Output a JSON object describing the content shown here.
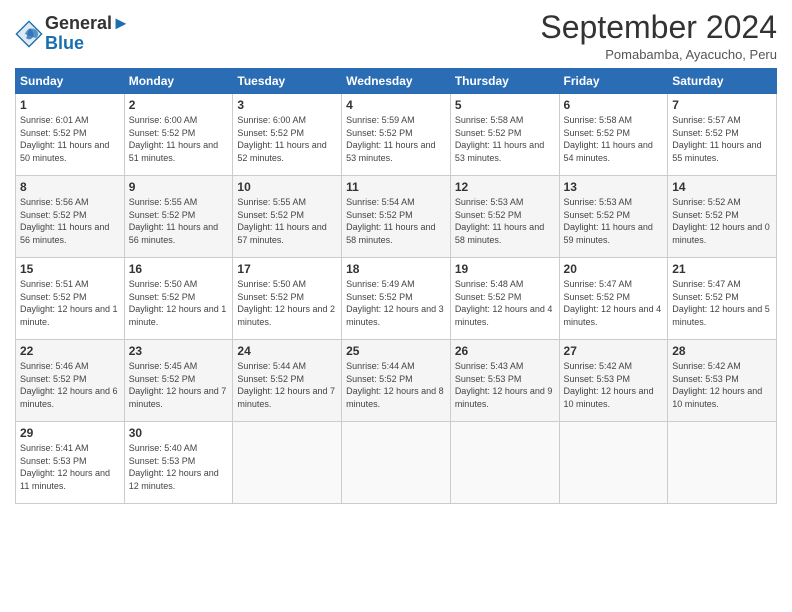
{
  "header": {
    "logo_line1": "General",
    "logo_line2": "Blue",
    "month_title": "September 2024",
    "location": "Pomabamba, Ayacucho, Peru"
  },
  "days_of_week": [
    "Sunday",
    "Monday",
    "Tuesday",
    "Wednesday",
    "Thursday",
    "Friday",
    "Saturday"
  ],
  "weeks": [
    [
      {
        "day": "1",
        "sunrise": "6:01 AM",
        "sunset": "5:52 PM",
        "daylight": "11 hours and 50 minutes."
      },
      {
        "day": "2",
        "sunrise": "6:00 AM",
        "sunset": "5:52 PM",
        "daylight": "11 hours and 51 minutes."
      },
      {
        "day": "3",
        "sunrise": "6:00 AM",
        "sunset": "5:52 PM",
        "daylight": "11 hours and 52 minutes."
      },
      {
        "day": "4",
        "sunrise": "5:59 AM",
        "sunset": "5:52 PM",
        "daylight": "11 hours and 53 minutes."
      },
      {
        "day": "5",
        "sunrise": "5:58 AM",
        "sunset": "5:52 PM",
        "daylight": "11 hours and 53 minutes."
      },
      {
        "day": "6",
        "sunrise": "5:58 AM",
        "sunset": "5:52 PM",
        "daylight": "11 hours and 54 minutes."
      },
      {
        "day": "7",
        "sunrise": "5:57 AM",
        "sunset": "5:52 PM",
        "daylight": "11 hours and 55 minutes."
      }
    ],
    [
      {
        "day": "8",
        "sunrise": "5:56 AM",
        "sunset": "5:52 PM",
        "daylight": "11 hours and 56 minutes."
      },
      {
        "day": "9",
        "sunrise": "5:55 AM",
        "sunset": "5:52 PM",
        "daylight": "11 hours and 56 minutes."
      },
      {
        "day": "10",
        "sunrise": "5:55 AM",
        "sunset": "5:52 PM",
        "daylight": "11 hours and 57 minutes."
      },
      {
        "day": "11",
        "sunrise": "5:54 AM",
        "sunset": "5:52 PM",
        "daylight": "11 hours and 58 minutes."
      },
      {
        "day": "12",
        "sunrise": "5:53 AM",
        "sunset": "5:52 PM",
        "daylight": "11 hours and 58 minutes."
      },
      {
        "day": "13",
        "sunrise": "5:53 AM",
        "sunset": "5:52 PM",
        "daylight": "11 hours and 59 minutes."
      },
      {
        "day": "14",
        "sunrise": "5:52 AM",
        "sunset": "5:52 PM",
        "daylight": "12 hours and 0 minutes."
      }
    ],
    [
      {
        "day": "15",
        "sunrise": "5:51 AM",
        "sunset": "5:52 PM",
        "daylight": "12 hours and 1 minute."
      },
      {
        "day": "16",
        "sunrise": "5:50 AM",
        "sunset": "5:52 PM",
        "daylight": "12 hours and 1 minute."
      },
      {
        "day": "17",
        "sunrise": "5:50 AM",
        "sunset": "5:52 PM",
        "daylight": "12 hours and 2 minutes."
      },
      {
        "day": "18",
        "sunrise": "5:49 AM",
        "sunset": "5:52 PM",
        "daylight": "12 hours and 3 minutes."
      },
      {
        "day": "19",
        "sunrise": "5:48 AM",
        "sunset": "5:52 PM",
        "daylight": "12 hours and 4 minutes."
      },
      {
        "day": "20",
        "sunrise": "5:47 AM",
        "sunset": "5:52 PM",
        "daylight": "12 hours and 4 minutes."
      },
      {
        "day": "21",
        "sunrise": "5:47 AM",
        "sunset": "5:52 PM",
        "daylight": "12 hours and 5 minutes."
      }
    ],
    [
      {
        "day": "22",
        "sunrise": "5:46 AM",
        "sunset": "5:52 PM",
        "daylight": "12 hours and 6 minutes."
      },
      {
        "day": "23",
        "sunrise": "5:45 AM",
        "sunset": "5:52 PM",
        "daylight": "12 hours and 7 minutes."
      },
      {
        "day": "24",
        "sunrise": "5:44 AM",
        "sunset": "5:52 PM",
        "daylight": "12 hours and 7 minutes."
      },
      {
        "day": "25",
        "sunrise": "5:44 AM",
        "sunset": "5:52 PM",
        "daylight": "12 hours and 8 minutes."
      },
      {
        "day": "26",
        "sunrise": "5:43 AM",
        "sunset": "5:53 PM",
        "daylight": "12 hours and 9 minutes."
      },
      {
        "day": "27",
        "sunrise": "5:42 AM",
        "sunset": "5:53 PM",
        "daylight": "12 hours and 10 minutes."
      },
      {
        "day": "28",
        "sunrise": "5:42 AM",
        "sunset": "5:53 PM",
        "daylight": "12 hours and 10 minutes."
      }
    ],
    [
      {
        "day": "29",
        "sunrise": "5:41 AM",
        "sunset": "5:53 PM",
        "daylight": "12 hours and 11 minutes."
      },
      {
        "day": "30",
        "sunrise": "5:40 AM",
        "sunset": "5:53 PM",
        "daylight": "12 hours and 12 minutes."
      },
      null,
      null,
      null,
      null,
      null
    ]
  ]
}
